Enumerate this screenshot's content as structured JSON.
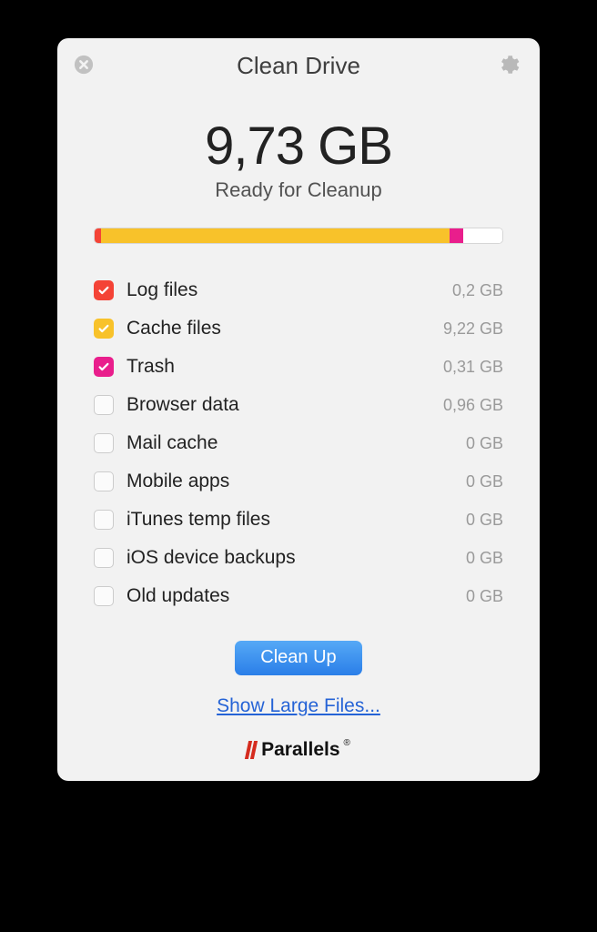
{
  "header": {
    "title": "Clean Drive"
  },
  "summary": {
    "size": "9,73 GB",
    "status": "Ready for Cleanup"
  },
  "progress": {
    "segments": [
      {
        "color": "#f44336",
        "pct": 1.5
      },
      {
        "color": "#f8c22a",
        "pct": 85.5
      },
      {
        "color": "#e91e8c",
        "pct": 3.5
      }
    ]
  },
  "items": [
    {
      "label": "Log files",
      "size": "0,2 GB",
      "checked": true,
      "color": "red"
    },
    {
      "label": "Cache files",
      "size": "9,22 GB",
      "checked": true,
      "color": "yellow"
    },
    {
      "label": "Trash",
      "size": "0,31 GB",
      "checked": true,
      "color": "pink"
    },
    {
      "label": "Browser data",
      "size": "0,96 GB",
      "checked": false,
      "color": ""
    },
    {
      "label": "Mail cache",
      "size": "0 GB",
      "checked": false,
      "color": ""
    },
    {
      "label": "Mobile apps",
      "size": "0 GB",
      "checked": false,
      "color": ""
    },
    {
      "label": "iTunes temp files",
      "size": "0 GB",
      "checked": false,
      "color": ""
    },
    {
      "label": "iOS device backups",
      "size": "0 GB",
      "checked": false,
      "color": ""
    },
    {
      "label": "Old updates",
      "size": "0 GB",
      "checked": false,
      "color": ""
    }
  ],
  "actions": {
    "clean_button": "Clean Up",
    "show_link": "Show Large Files..."
  },
  "brand": {
    "name": "Parallels"
  }
}
